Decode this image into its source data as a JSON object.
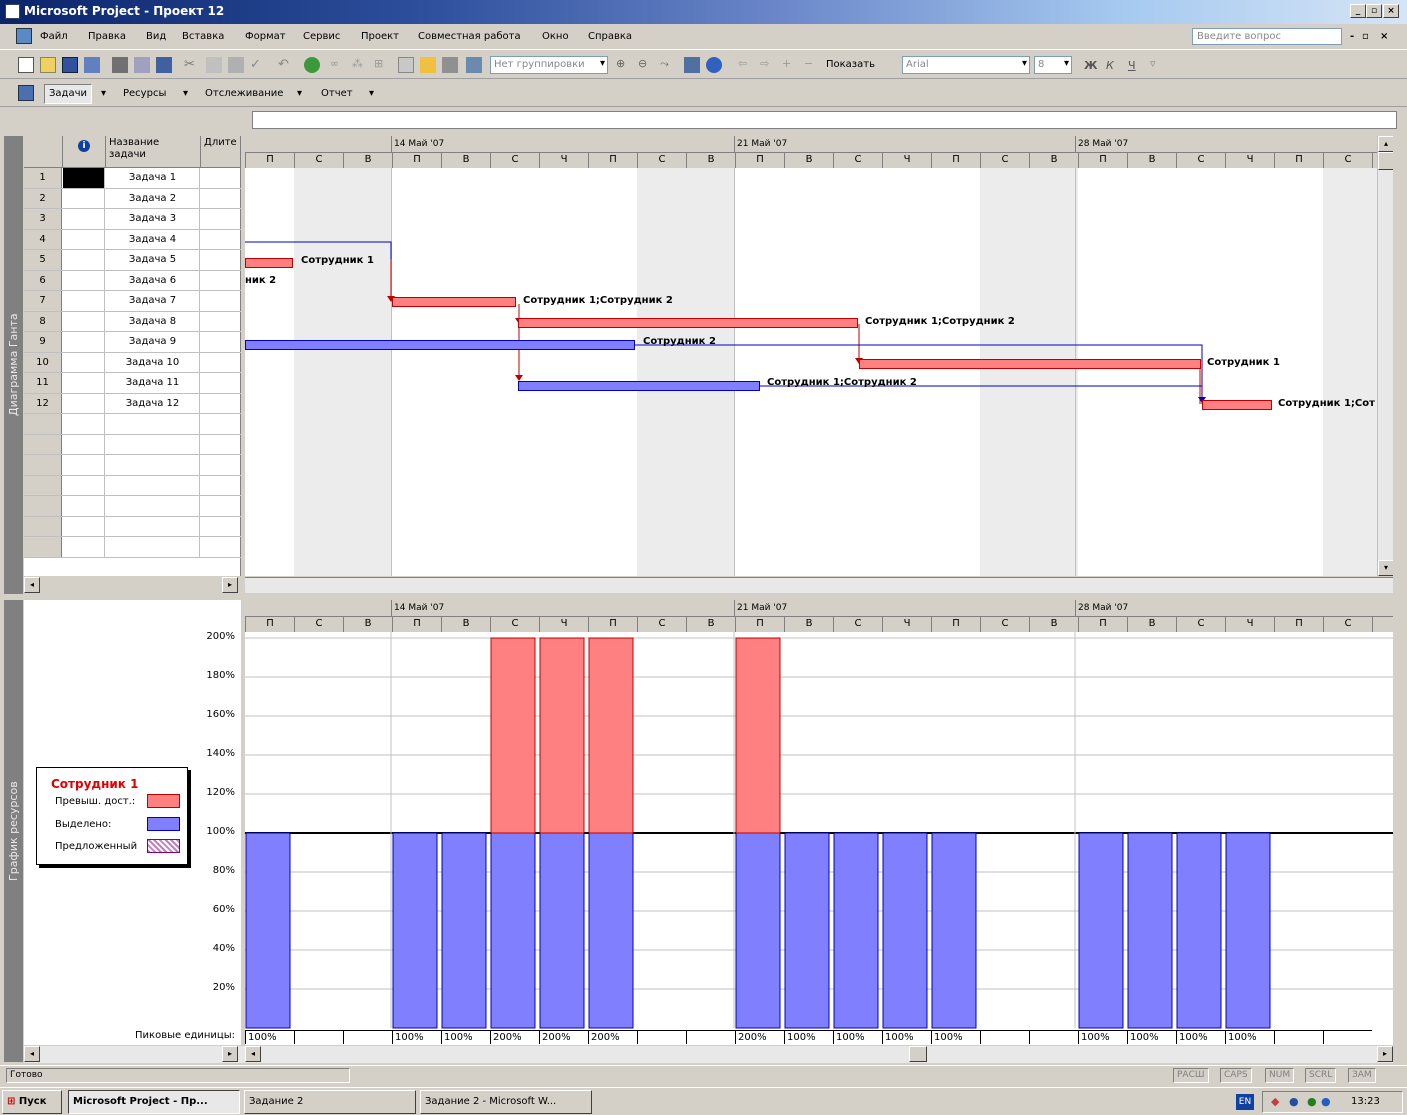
{
  "window": {
    "title": "Microsoft Project - Проект 12"
  },
  "menu": [
    "Файл",
    "Правка",
    "Вид",
    "Вставка",
    "Формат",
    "Сервис",
    "Проект",
    "Совместная работа",
    "Окно",
    "Справка"
  ],
  "ask_placeholder": "Введите вопрос",
  "toolbar": {
    "grouping": "Нет группировки",
    "show": "Показать",
    "font": "Arial",
    "size": "8",
    "bold": "Ж",
    "italic": "К",
    "underline": "Ч"
  },
  "toolbar3": {
    "tasks": "Задачи",
    "resources": "Ресурсы",
    "tracking": "Отслеживание",
    "report": "Отчет"
  },
  "side_labels": {
    "gantt": "Диаграмма Ганта",
    "resource_graph": "График ресурсов"
  },
  "table": {
    "col_info": "i",
    "col_name": "Название задачи",
    "col_duration": "Длите",
    "rows": [
      {
        "n": "1",
        "name": "Задача 1"
      },
      {
        "n": "2",
        "name": "Задача 2"
      },
      {
        "n": "3",
        "name": "Задача 3"
      },
      {
        "n": "4",
        "name": "Задача 4"
      },
      {
        "n": "5",
        "name": "Задача 5"
      },
      {
        "n": "6",
        "name": "Задача 6"
      },
      {
        "n": "7",
        "name": "Задача 7"
      },
      {
        "n": "8",
        "name": "Задача 8"
      },
      {
        "n": "9",
        "name": "Задача 9"
      },
      {
        "n": "10",
        "name": "Задача 10"
      },
      {
        "n": "11",
        "name": "Задача 11"
      },
      {
        "n": "12",
        "name": "Задача 12"
      }
    ]
  },
  "timescale": {
    "weeks": [
      "14 Май '07",
      "21 Май '07",
      "28 Май '07"
    ],
    "days": [
      "П",
      "С",
      "В",
      "П",
      "В",
      "С",
      "Ч",
      "П",
      "С",
      "В",
      "П",
      "В",
      "С",
      "Ч",
      "П",
      "С",
      "В",
      "П",
      "В",
      "С",
      "Ч",
      "П",
      "С",
      "В"
    ]
  },
  "gantt_labels": {
    "t5": "Сотрудник 1",
    "t6": "ник 2",
    "t7": "Сотрудник 1;Сотрудник 2",
    "t8": "Сотрудник 1;Сотрудник 2",
    "t9": "Сотрудник 2",
    "t10": "Сотрудник 1",
    "t11": "Сотрудник 1;Сотрудник 2",
    "t12": "Сотрудник 1;Сот"
  },
  "chart_data": {
    "type": "bar",
    "title": "Сотрудник 1",
    "ylim": [
      0,
      200
    ],
    "yticks": [
      "200%",
      "180%",
      "160%",
      "140%",
      "120%",
      "100%",
      "80%",
      "60%",
      "40%",
      "20%"
    ],
    "categories": [
      "П",
      "С",
      "В",
      "П",
      "В",
      "С",
      "Ч",
      "П",
      "С",
      "В",
      "П",
      "В",
      "С",
      "Ч",
      "П",
      "С",
      "В",
      "П",
      "В",
      "С",
      "Ч",
      "П",
      "С"
    ],
    "series": [
      {
        "name": "Выделено:",
        "color": "#8080ff",
        "values": [
          100,
          0,
          0,
          100,
          100,
          100,
          100,
          100,
          0,
          0,
          100,
          100,
          100,
          100,
          100,
          0,
          0,
          100,
          100,
          100,
          100,
          0,
          0
        ]
      },
      {
        "name": "Превыш. дост.:",
        "color": "#ff8080",
        "values": [
          0,
          0,
          0,
          0,
          0,
          100,
          100,
          100,
          0,
          0,
          100,
          0,
          0,
          0,
          0,
          0,
          0,
          0,
          0,
          0,
          0,
          0,
          0
        ]
      },
      {
        "name": "Предложенный",
        "color": "#c080c0",
        "values": []
      }
    ],
    "peak_label": "Пиковые единицы:",
    "peak_units": [
      "100%",
      "",
      "",
      "100%",
      "100%",
      "200%",
      "200%",
      "200%",
      "",
      "",
      "200%",
      "100%",
      "100%",
      "100%",
      "100%",
      "",
      "",
      "100%",
      "100%",
      "100%",
      "100%",
      "",
      ""
    ]
  },
  "status": {
    "text": "Готово",
    "indicators": [
      "РАСШ",
      "CAPS",
      "NUM",
      "SCRL",
      "ЗАМ"
    ]
  },
  "taskbar": {
    "start": "Пуск",
    "items": [
      "Microsoft Project - Пр...",
      "Задание 2",
      "Задание 2 - Microsoft W..."
    ],
    "lang": "EN",
    "clock": "13:23"
  }
}
